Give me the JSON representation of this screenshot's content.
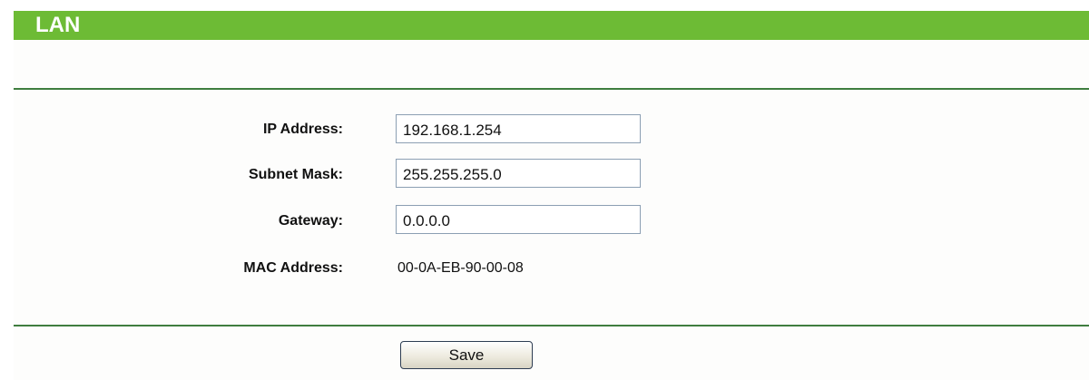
{
  "header": {
    "title": "LAN",
    "accent_color": "#6dbb35",
    "divider_color": "#3f7d3f"
  },
  "form": {
    "ip_address": {
      "label": "IP Address:",
      "value": "192.168.1.254"
    },
    "subnet_mask": {
      "label": "Subnet Mask:",
      "value": "255.255.255.0"
    },
    "gateway": {
      "label": "Gateway:",
      "value": "0.0.0.0"
    },
    "mac_address": {
      "label": "MAC Address:",
      "value": "00-0A-EB-90-00-08"
    }
  },
  "actions": {
    "save_label": "Save"
  }
}
